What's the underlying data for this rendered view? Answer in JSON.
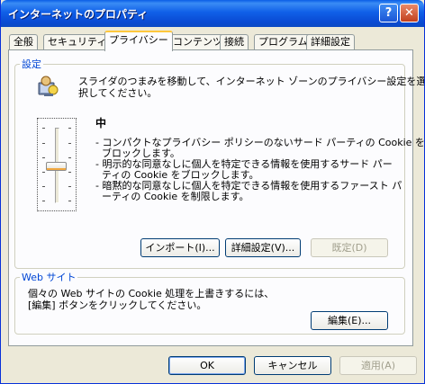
{
  "window": {
    "title": "インターネットのプロパティ"
  },
  "titlebar": {
    "help_label": "?",
    "close_label": "✕"
  },
  "tabs": [
    {
      "label": "全般"
    },
    {
      "label": "セキュリティ"
    },
    {
      "label": "プライバシー"
    },
    {
      "label": "コンテンツ"
    },
    {
      "label": "接続"
    },
    {
      "label": "プログラム"
    },
    {
      "label": "詳細設定"
    }
  ],
  "settings_group": {
    "label": "設定",
    "instruction_line1": "スライダのつまみを移動して、インターネット ゾーンのプライバシー設定を選",
    "instruction_line2": "択してください。",
    "level_title": "中",
    "desc_lines": [
      "- コンパクトなプライバシー ポリシーのないサード パーティの Cookie を",
      "  ブロックします。",
      "- 明示的な同意なしに個人を特定できる情報を使用するサード パー",
      "  ティの Cookie をブロックします。",
      "- 暗黙的な同意なしに個人を特定できる情報を使用するファースト パ",
      "  ーティの Cookie を制限します。"
    ],
    "import_label": "インポート(I)...",
    "advanced_label": "詳細設定(V)...",
    "default_label": "既定(D)"
  },
  "websites_group": {
    "label": "Web サイト",
    "desc_line1": "個々の Web サイトの Cookie 処理を上書きするには、",
    "desc_line2": "[編集] ボタンをクリックしてください。",
    "edit_label": "編集(E)..."
  },
  "footer": {
    "ok_label": "OK",
    "cancel_label": "キャンセル",
    "apply_label": "適用(A)"
  },
  "colors": {
    "accent": "#0046d5",
    "titlebar": "#0a5de6",
    "tab_highlight": "#ffc83c"
  }
}
